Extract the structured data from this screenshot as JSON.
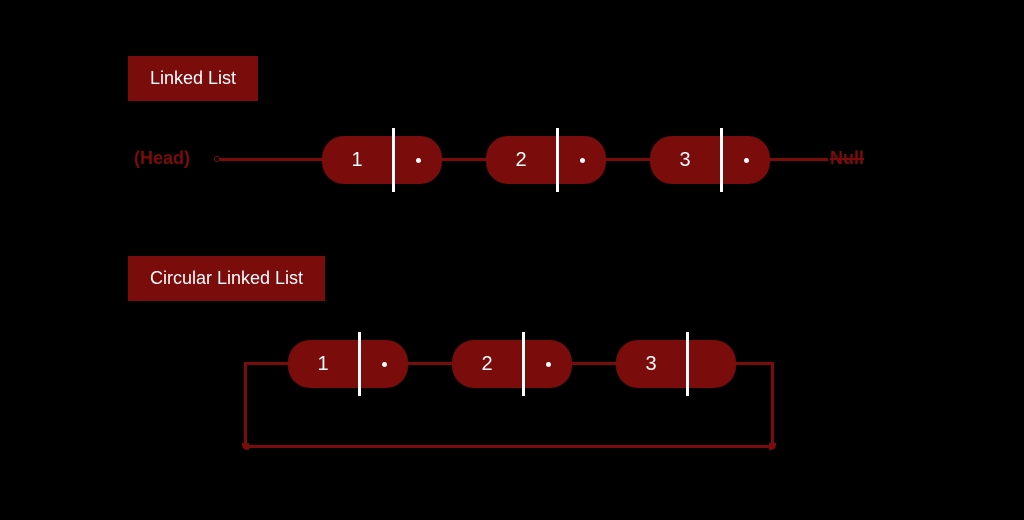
{
  "diagram": {
    "sections": [
      {
        "title": "Linked List",
        "head_label": "(Head)",
        "null_label": "Null",
        "nodes": [
          "1",
          "2",
          "3"
        ]
      },
      {
        "title": "Circular Linked List",
        "nodes": [
          "1",
          "2",
          "3"
        ]
      }
    ],
    "colors": {
      "accent": "#7a0c0c",
      "bg": "#000000",
      "text": "#ffffff"
    }
  }
}
